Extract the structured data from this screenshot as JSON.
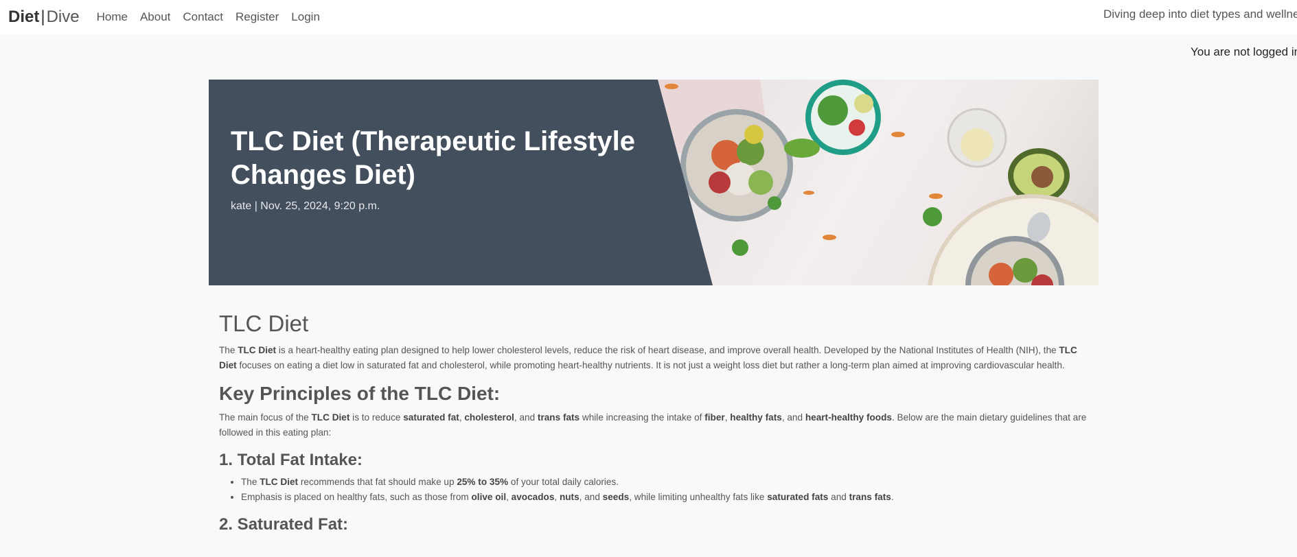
{
  "navbar": {
    "brand_bold": "Diet",
    "brand_sep": "|",
    "brand_light": "Dive",
    "links": [
      "Home",
      "About",
      "Contact",
      "Register",
      "Login"
    ],
    "tagline": "Diving deep into diet types and wellness"
  },
  "login_status": "You are not logged in",
  "hero": {
    "title": "TLC Diet (Therapeutic Lifestyle Changes Diet)",
    "meta": "kate | Nov. 25, 2024, 9:20 p.m."
  },
  "article": {
    "heading": "TLC Diet",
    "intro": [
      "The ",
      "TLC Diet",
      " is a heart-healthy eating plan designed to help lower cholesterol levels, reduce the risk of heart disease, and improve overall health. Developed by the National Institutes of Health (NIH), the ",
      "TLC Diet",
      " focuses on eating a diet low in saturated fat and cholesterol, while promoting heart-healthy nutrients. It is not just a weight loss diet but rather a long-term plan aimed at improving cardiovascular health."
    ],
    "principles_heading": "Key Principles of the TLC Diet:",
    "principles_text": [
      "The main focus of the ",
      "TLC Diet",
      " is to reduce ",
      "saturated fat",
      ", ",
      "cholesterol",
      ", and ",
      "trans fats",
      " while increasing the intake of ",
      "fiber",
      ", ",
      "healthy fats",
      ", and ",
      "heart-healthy foods",
      ". Below are the main dietary guidelines that are followed in this eating plan:"
    ],
    "section1_heading": "1. Total Fat Intake:",
    "section1_items": [
      [
        "The ",
        "TLC Diet",
        " recommends that fat should make up ",
        "25% to 35%",
        " of your total daily calories."
      ],
      [
        "Emphasis is placed on healthy fats, such as those from ",
        "olive oil",
        ", ",
        "avocados",
        ", ",
        "nuts",
        ", and ",
        "seeds",
        ", while limiting unhealthy fats like ",
        "saturated fats",
        " and ",
        "trans fats",
        "."
      ]
    ],
    "section2_heading": "2. Saturated Fat:"
  }
}
